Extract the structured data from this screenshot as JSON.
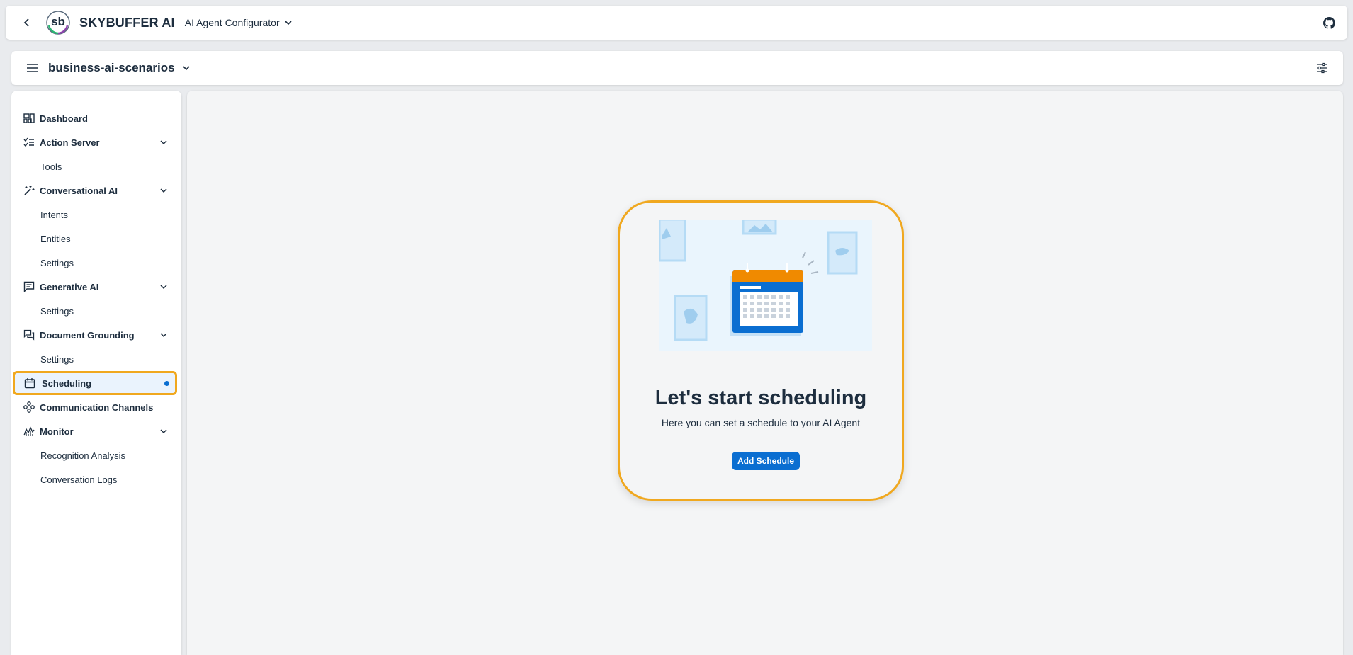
{
  "shellbar": {
    "brand": "SKYBUFFER AI",
    "logo_text": "sb",
    "product": "AI Agent Configurator"
  },
  "subheader": {
    "workspace": "business-ai-scenarios"
  },
  "sidebar": {
    "items": [
      {
        "label": "Dashboard",
        "level": "top",
        "icon": "dashboard-icon"
      },
      {
        "label": "Action Server",
        "level": "top",
        "icon": "checklist-icon",
        "expandable": true
      },
      {
        "label": "Tools",
        "level": "sub"
      },
      {
        "label": "Conversational AI",
        "level": "top",
        "icon": "magic-wand-icon",
        "expandable": true
      },
      {
        "label": "Intents",
        "level": "sub"
      },
      {
        "label": "Entities",
        "level": "sub"
      },
      {
        "label": "Settings",
        "level": "sub"
      },
      {
        "label": "Generative AI",
        "level": "top",
        "icon": "message-icon",
        "expandable": true
      },
      {
        "label": "Settings",
        "level": "sub"
      },
      {
        "label": "Document Grounding",
        "level": "top",
        "icon": "discussion-icon",
        "expandable": true
      },
      {
        "label": "Settings",
        "level": "sub"
      },
      {
        "label": "Scheduling",
        "level": "top",
        "icon": "calendar-icon",
        "selected": true
      },
      {
        "label": "Communication Channels",
        "level": "top",
        "icon": "network-icon"
      },
      {
        "label": "Monitor",
        "level": "top",
        "icon": "monitor-chart-icon",
        "expandable": true
      },
      {
        "label": "Recognition Analysis",
        "level": "sub"
      },
      {
        "label": "Conversation Logs",
        "level": "sub"
      }
    ]
  },
  "empty_state": {
    "title": "Let's start scheduling",
    "subtitle": "Here you can set a schedule to your AI Agent",
    "button_label": "Add Schedule"
  },
  "colors": {
    "accent": "#0a6ed1",
    "highlight": "#f0a81f",
    "calendar_header": "#f08a00"
  }
}
